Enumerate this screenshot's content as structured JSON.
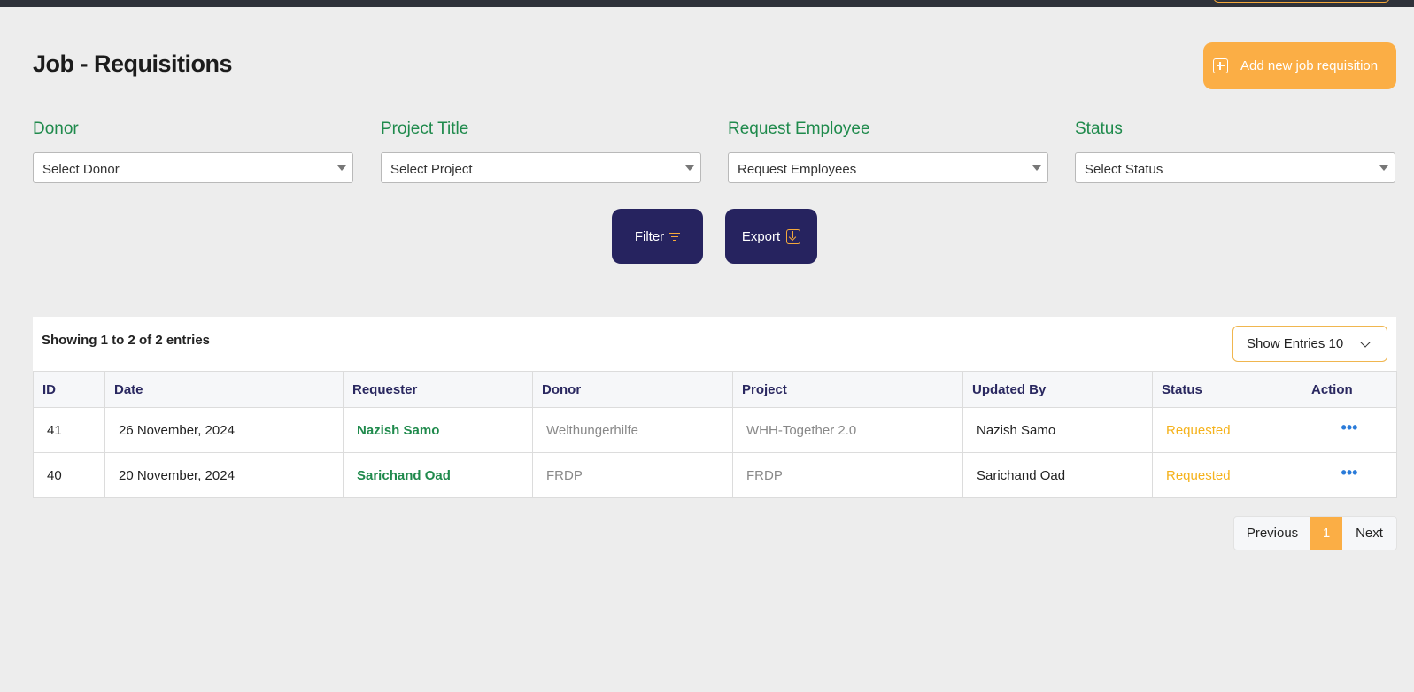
{
  "page": {
    "title": "Job - Requisitions",
    "add_button_label": "Add new job requisition"
  },
  "filters": [
    {
      "label": "Donor",
      "placeholder": "Select Donor"
    },
    {
      "label": "Project Title",
      "placeholder": "Select Project"
    },
    {
      "label": "Request Employee",
      "placeholder": "Request Employees"
    },
    {
      "label": "Status",
      "placeholder": "Select Status"
    }
  ],
  "actions": {
    "filter_label": "Filter",
    "export_label": "Export"
  },
  "table": {
    "showing_text": "Showing 1 to 2 of 2 entries",
    "entries_select_label": "Show Entries 10",
    "columns": [
      "ID",
      "Date",
      "Requester",
      "Donor",
      "Project",
      "Updated By",
      "Status",
      "Action"
    ],
    "rows": [
      {
        "id": "41",
        "date": "26 November, 2024",
        "requester": "Nazish Samo",
        "donor": "Welthungerhilfe",
        "project": "WHH-Together 2.0",
        "updated_by": "Nazish Samo",
        "status": "Requested",
        "action": "•••"
      },
      {
        "id": "40",
        "date": "20 November, 2024",
        "requester": "Sarichand Oad",
        "donor": "FRDP",
        "project": "FRDP",
        "updated_by": "Sarichand Oad",
        "status": "Requested",
        "action": "•••"
      }
    ]
  },
  "pagination": {
    "previous_label": "Previous",
    "current_page": "1",
    "next_label": "Next"
  },
  "colors": {
    "accent_orange": "#fbae45",
    "primary_navy": "#26235f",
    "label_green": "#1f8a4c",
    "status_orange": "#f5b21b",
    "action_blue": "#2a7bd9"
  },
  "icons": [
    "plus-square-icon",
    "caret-down-icon",
    "filter-lines-icon",
    "export-download-icon",
    "chevron-down-icon",
    "more-dots-icon"
  ]
}
